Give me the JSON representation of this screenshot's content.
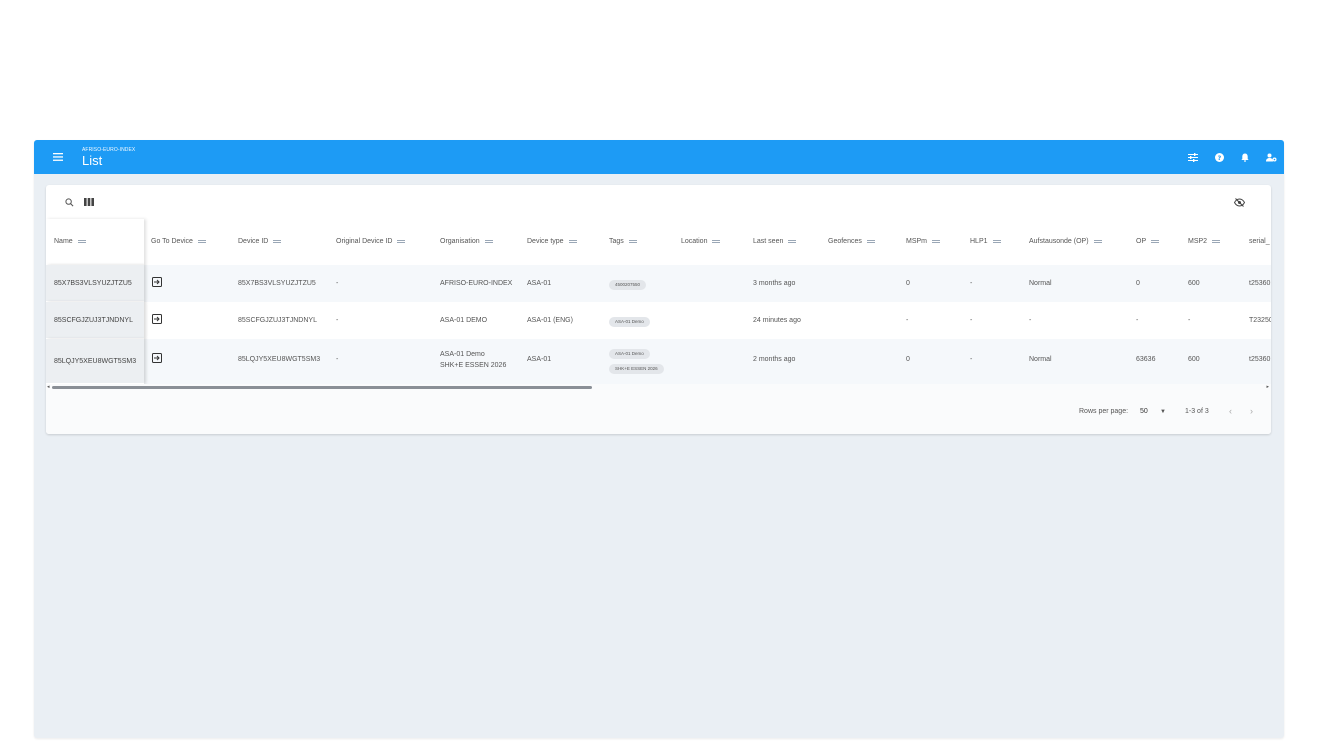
{
  "appbar": {
    "subtitle": "AFRISO-EURO-INDEX",
    "title": "List",
    "actions": [
      "tune-icon",
      "help-icon",
      "bell-icon",
      "account-settings-icon"
    ]
  },
  "toolbar": {
    "search_icon": "search-icon",
    "columns_icon": "columns-icon",
    "visibility_icon": "eye-off-icon"
  },
  "table": {
    "columns": [
      "Name",
      "Go To Device",
      "Device ID",
      "Original Device ID",
      "Organisation",
      "Device type",
      "Tags",
      "Location",
      "Last seen",
      "Geofences",
      "MSPm",
      "HLP1",
      "Aufstausonde (OP)",
      "OP",
      "MSP2",
      "serial_"
    ],
    "rows": [
      {
        "name": "85X7BS3VLSYUZJTZU5",
        "device_id": "85X7BS3VLSYUZJTZU5",
        "original_id": "-",
        "organisation": "AFRISO-EURO-INDEX",
        "organisation2": "",
        "device_type": "ASA-01",
        "tags": [
          "4500207550"
        ],
        "location": "",
        "last_seen": "3 months ago",
        "geofences": "",
        "mspm": "0",
        "hlp1": "-",
        "aufstausonde": "Normal",
        "op": "0",
        "msp2": "600",
        "serial": "t25360"
      },
      {
        "name": "85SCFGJZUJ3TJNDNYL",
        "device_id": "85SCFGJZUJ3TJNDNYL",
        "original_id": "-",
        "organisation": "ASA-01 DEMO",
        "organisation2": "",
        "device_type": "ASA-01 (ENG)",
        "tags": [
          "ASA-01 Demo"
        ],
        "location": "",
        "last_seen": "24 minutes ago",
        "geofences": "",
        "mspm": "-",
        "hlp1": "-",
        "aufstausonde": "-",
        "op": "-",
        "msp2": "-",
        "serial": "T23250"
      },
      {
        "name": "85LQJY5XEU8WGT5SM3",
        "device_id": "85LQJY5XEU8WGT5SM3",
        "original_id": "-",
        "organisation": "ASA-01 Demo",
        "organisation2": "SHK+E ESSEN 2026",
        "device_type": "ASA-01",
        "tags": [
          "ASA-01 Demo",
          "SHK+E ESSEN 2026"
        ],
        "location": "",
        "last_seen": "2 months ago",
        "geofences": "",
        "mspm": "0",
        "hlp1": "-",
        "aufstausonde": "Normal",
        "op": "63636",
        "msp2": "600",
        "serial": "t25360"
      }
    ]
  },
  "pagination": {
    "rows_per_page_label": "Rows per page:",
    "rows_per_page_value": "50",
    "range": "1-3 of 3"
  },
  "colors": {
    "appbar": "#1d9bf5",
    "background": "#eaeff4",
    "selected_column": "#eceff2"
  }
}
